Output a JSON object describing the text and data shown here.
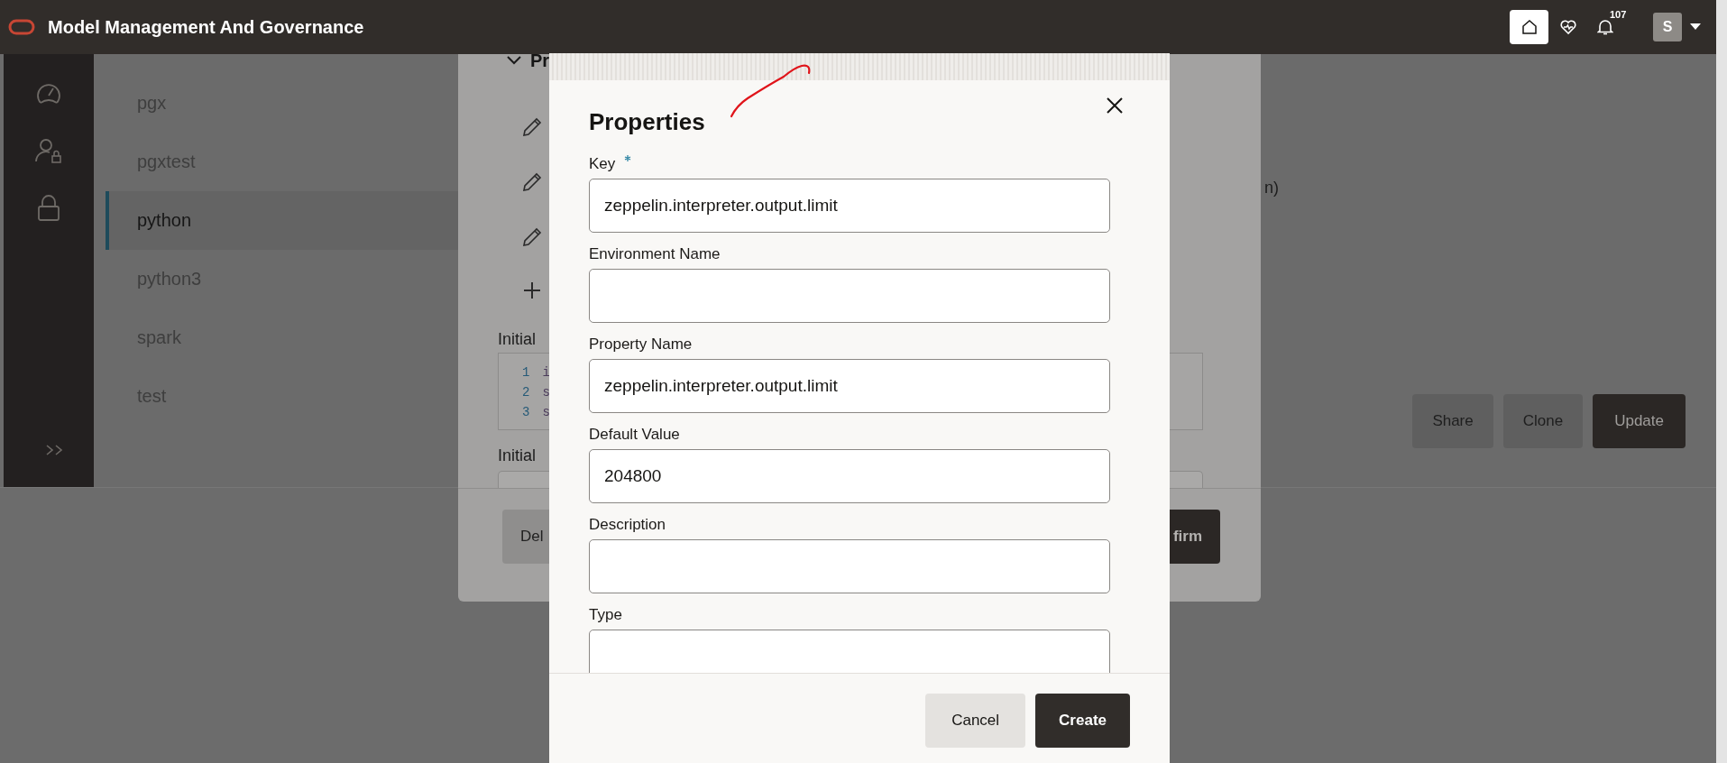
{
  "header": {
    "title": "Model Management And Governance",
    "notification_count": "107",
    "avatar_initial": "S"
  },
  "interpreters": [
    {
      "name": "pgx",
      "selected": false
    },
    {
      "name": "pgxtest",
      "selected": false
    },
    {
      "name": "python",
      "selected": true
    },
    {
      "name": "python3",
      "selected": false
    },
    {
      "name": "spark",
      "selected": false
    },
    {
      "name": "test",
      "selected": false
    }
  ],
  "detail_fragment": "n)",
  "actions": [
    {
      "label": "Share",
      "kind": "secondary"
    },
    {
      "label": "Clone",
      "kind": "secondary"
    },
    {
      "label": "Update",
      "kind": "primary"
    }
  ],
  "background_dialog": {
    "section_title": "Pr",
    "initial_labels": [
      "Initial",
      "Initial"
    ],
    "code_lines": [
      {
        "number": "1",
        "text": "i"
      },
      {
        "number": "2",
        "text": "s"
      },
      {
        "number": "3",
        "text": "s"
      }
    ],
    "buttons": [
      {
        "label": "Del",
        "kind": "secondary"
      },
      {
        "label": "firm",
        "kind": "primary"
      }
    ]
  },
  "modal": {
    "title": "Properties",
    "fields": [
      {
        "label": "Key",
        "required": true,
        "value": "zeppelin.interpreter.output.limit"
      },
      {
        "label": "Environment Name",
        "required": false
      },
      {
        "label": "Property Name",
        "required": false,
        "value": "zeppelin.interpreter.output.limit"
      },
      {
        "label": "Default Value",
        "required": false,
        "value": "204800"
      },
      {
        "label": "Description",
        "required": false
      },
      {
        "label": "Type",
        "required": false
      }
    ],
    "buttons": [
      {
        "label": "Cancel",
        "kind": "secondary"
      },
      {
        "label": "Create",
        "kind": "primary"
      }
    ]
  }
}
